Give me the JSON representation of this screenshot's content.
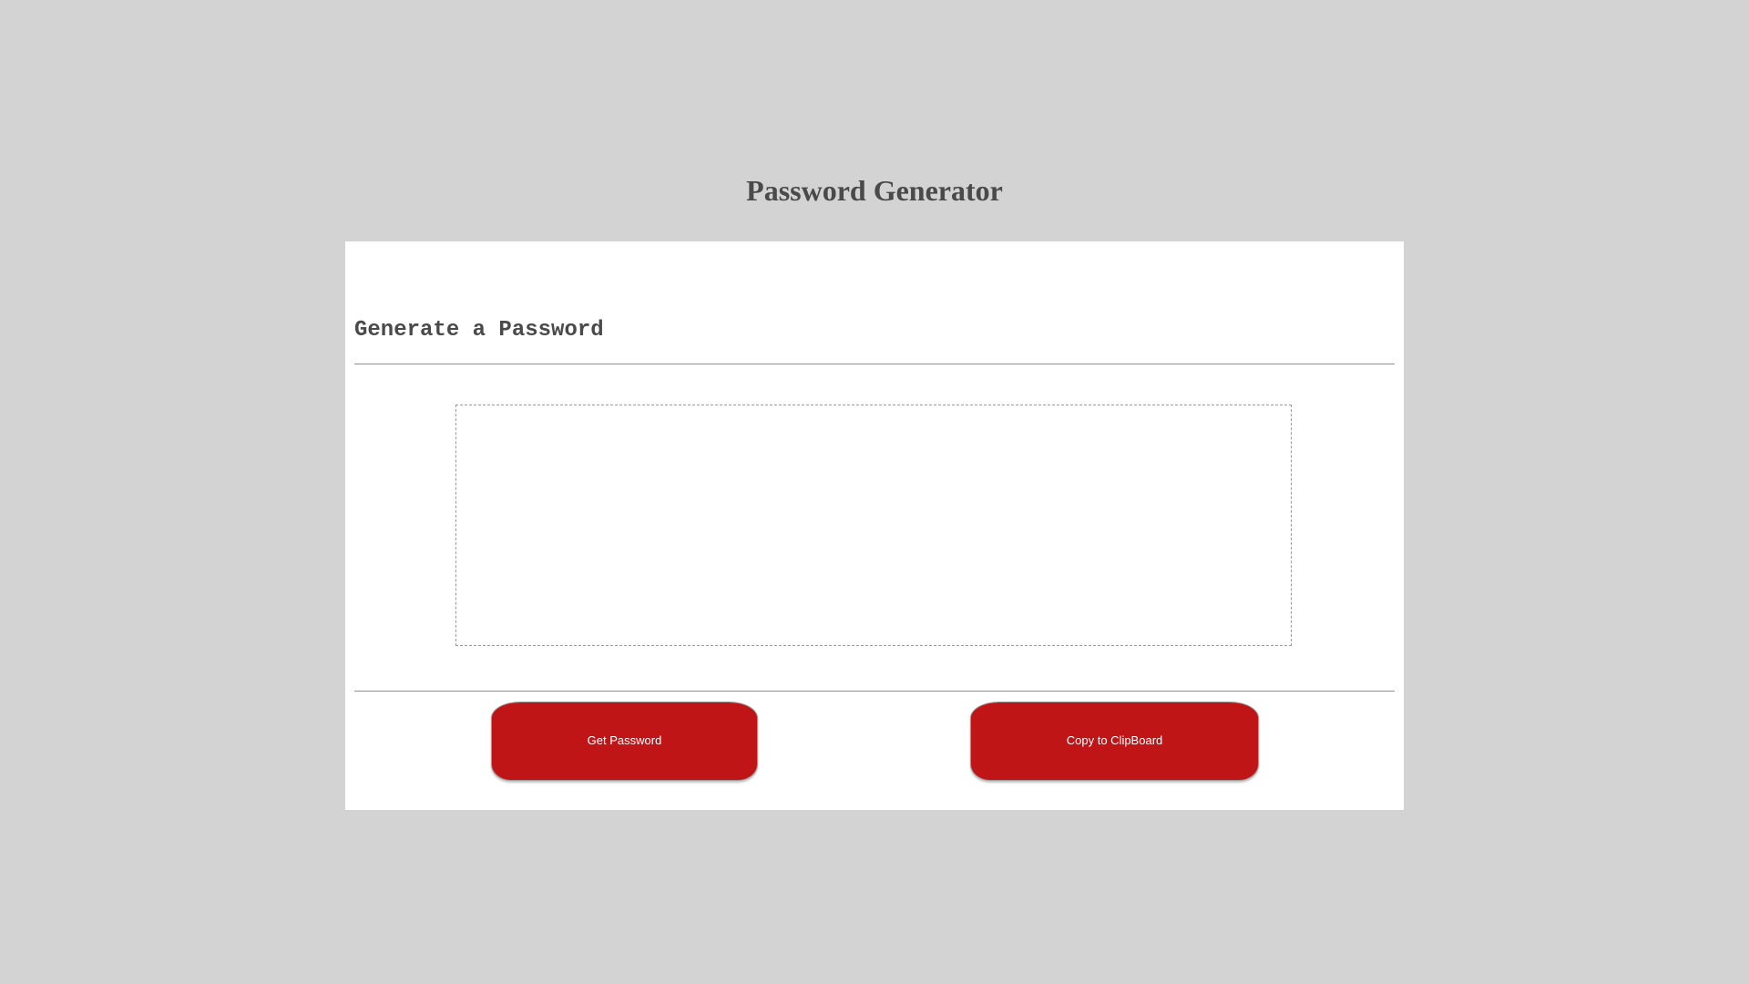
{
  "page": {
    "title": "Password Generator"
  },
  "card": {
    "header": "Generate a Password",
    "output": {
      "value": "",
      "placeholder": ""
    },
    "buttons": {
      "get_password": "Get Password",
      "copy_clipboard": "Copy to ClipBoard"
    }
  },
  "colors": {
    "background": "#d3d3d3",
    "card_background": "#ffffff",
    "button_red": "#c01517",
    "text_gray": "#4a4a4a"
  }
}
